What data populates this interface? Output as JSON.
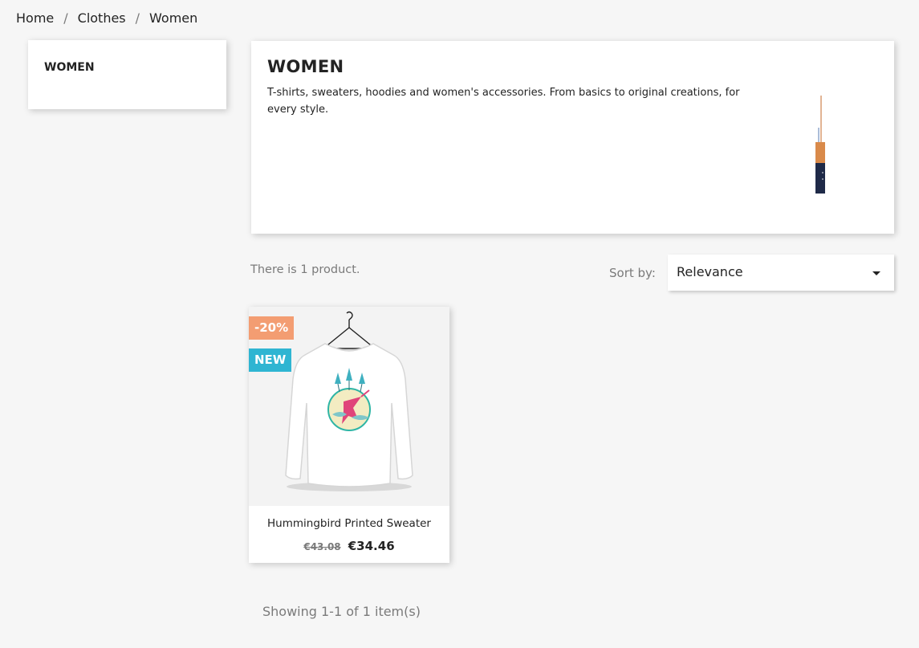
{
  "breadcrumb": {
    "items": [
      "Home",
      "Clothes",
      "Women"
    ],
    "separator": "/"
  },
  "sidebar": {
    "title": "WOMEN"
  },
  "category": {
    "title": "WOMEN",
    "description": "T-shirts, sweaters, hoodies and women's accessories. From basics to original creations, for every style."
  },
  "listing": {
    "product_count": "There is 1 product.",
    "sort_label": "Sort by:",
    "sort_value": "Relevance",
    "pagination_summary": "Showing 1-1 of 1 item(s)"
  },
  "products": [
    {
      "name": "Hummingbird Printed Sweater",
      "regular_price": "€43.08",
      "price": "€34.46",
      "flags": {
        "discount": "-20%",
        "new": "NEW"
      }
    }
  ],
  "colors": {
    "discount_flag": "#f39d72",
    "new_flag": "#2fb5d2",
    "background": "#f6f6f6"
  },
  "icons": [
    "caret-down-icon"
  ]
}
